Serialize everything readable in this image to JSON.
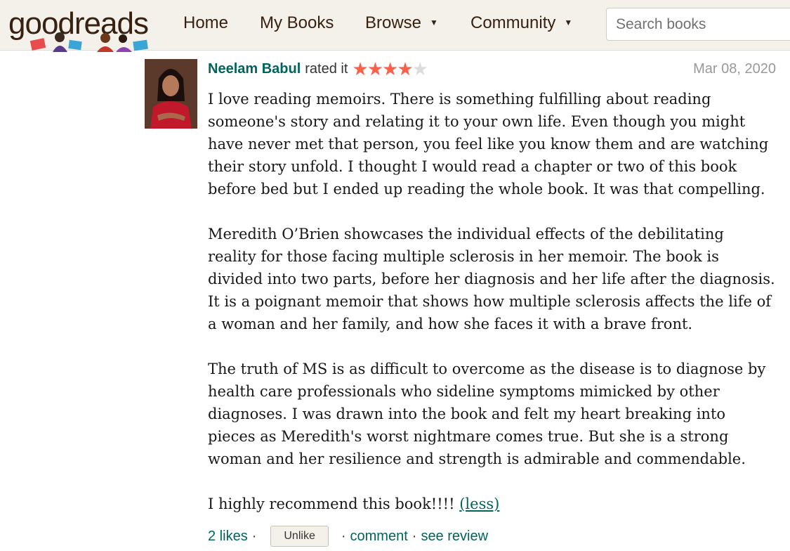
{
  "header": {
    "logo": "goodreads",
    "nav": [
      {
        "label": "Home"
      },
      {
        "label": "My Books"
      },
      {
        "label": "Browse",
        "caret": "▼"
      },
      {
        "label": "Community",
        "caret": "▼"
      }
    ],
    "search_placeholder": "Search books"
  },
  "review": {
    "reviewer": "Neelam Babul",
    "rated_text": "rated it",
    "rating": 4,
    "max_rating": 5,
    "date": "Mar 08, 2020",
    "paragraphs": [
      "I love reading memoirs. There is something fulfilling about reading someone's story and relating it to your own life. Even though you might have never met that person, you feel like you know them and are watching their story unfold. I thought I would read a chapter or two of this book before bed but I ended up reading the whole book. It was that compelling.",
      "Meredith O’Brien showcases the individual effects of the debilitating reality for those facing multiple sclerosis in her memoir. The book is divided into two parts, before her diagnosis and her life after the diagnosis. It is a poignant memoir that shows how multiple sclerosis affects the life of a woman and her family, and how she faces it with a brave front.",
      "The truth of MS is as difficult to overcome as the disease is to diagnose by health care professionals who sideline symptoms mimicked by other diagnoses. I was drawn into the book and felt my heart breaking into pieces as Meredith's worst nightmare comes true. But she is a strong woman and her resilience and strength is admirable and commendable.",
      "I highly recommend this book!!!!"
    ],
    "less_link": "(less)",
    "likes": "2 likes",
    "unlike_button": "Unlike",
    "comment_link": "comment",
    "see_review_link": "see review",
    "separator": "·"
  },
  "colors": {
    "header_bg": "#f4f1ea",
    "brand_brown": "#382110",
    "link_green": "#00635d",
    "star_on": "#fa604a",
    "star_off": "#dcdcdc"
  }
}
